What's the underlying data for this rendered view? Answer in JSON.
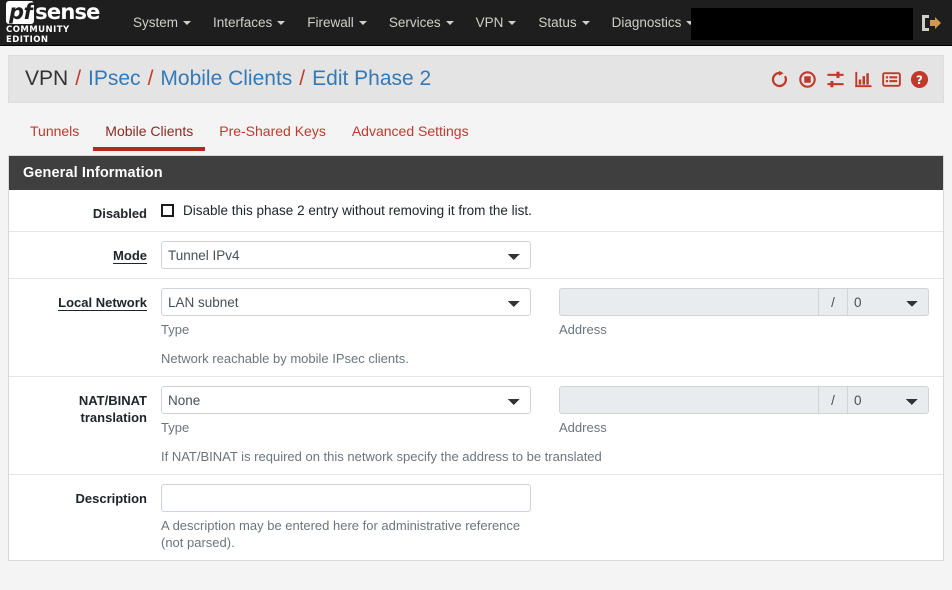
{
  "navbar": {
    "brand": {
      "pf": "pf",
      "sense": "sense",
      "edition": "COMMUNITY EDITION"
    },
    "menus": [
      {
        "label": "System",
        "has_caret": true
      },
      {
        "label": "Interfaces",
        "has_caret": true
      },
      {
        "label": "Firewall",
        "has_caret": true
      },
      {
        "label": "Services",
        "has_caret": true
      },
      {
        "label": "VPN",
        "has_caret": true
      },
      {
        "label": "Status",
        "has_caret": true
      },
      {
        "label": "Diagnostics",
        "has_caret": true
      }
    ],
    "redacted_region": "",
    "logout_icon": "sign-out-icon"
  },
  "breadcrumb": {
    "root": "VPN",
    "separator": "/",
    "links": [
      "IPsec",
      "Mobile Clients",
      "Edit Phase 2"
    ],
    "icons": [
      "refresh-icon",
      "stop-record-icon",
      "sliders-icon",
      "bar-chart-icon",
      "log-list-icon",
      "help-circle-icon"
    ]
  },
  "tabs": [
    {
      "label": "Tunnels",
      "active": false
    },
    {
      "label": "Mobile Clients",
      "active": true
    },
    {
      "label": "Pre-Shared Keys",
      "active": false
    },
    {
      "label": "Advanced Settings",
      "active": false
    }
  ],
  "panel": {
    "title": "General Information",
    "rows": {
      "disabled": {
        "label": "Disabled",
        "checkbox_label": "Disable this phase 2 entry without removing it from the list.",
        "checked": false
      },
      "mode": {
        "label": "Mode",
        "underlined": true,
        "value": "Tunnel IPv4"
      },
      "local_network": {
        "label": "Local Network",
        "underlined": true,
        "type_value": "LAN subnet",
        "type_help": "Type",
        "address_value": "",
        "address_help": "Address",
        "slash": "/",
        "prefix_value": "0",
        "note": "Network reachable by mobile IPsec clients."
      },
      "nat_binat": {
        "label": "NAT/BINAT translation",
        "underlined": false,
        "type_value": "None",
        "type_help": "Type",
        "address_value": "",
        "address_help": "Address",
        "slash": "/",
        "prefix_value": "0",
        "note": "If NAT/BINAT is required on this network specify the address to be translated"
      },
      "description": {
        "label": "Description",
        "value": "",
        "note": "A description may be entered here for administrative reference (not parsed)."
      }
    }
  },
  "colors": {
    "navbar_bg": "#1e1e1e",
    "accent_red": "#c0392b",
    "link_blue": "#337ab7",
    "panel_head_bg": "#3f3f3f",
    "page_bg": "#f4f4f4"
  }
}
